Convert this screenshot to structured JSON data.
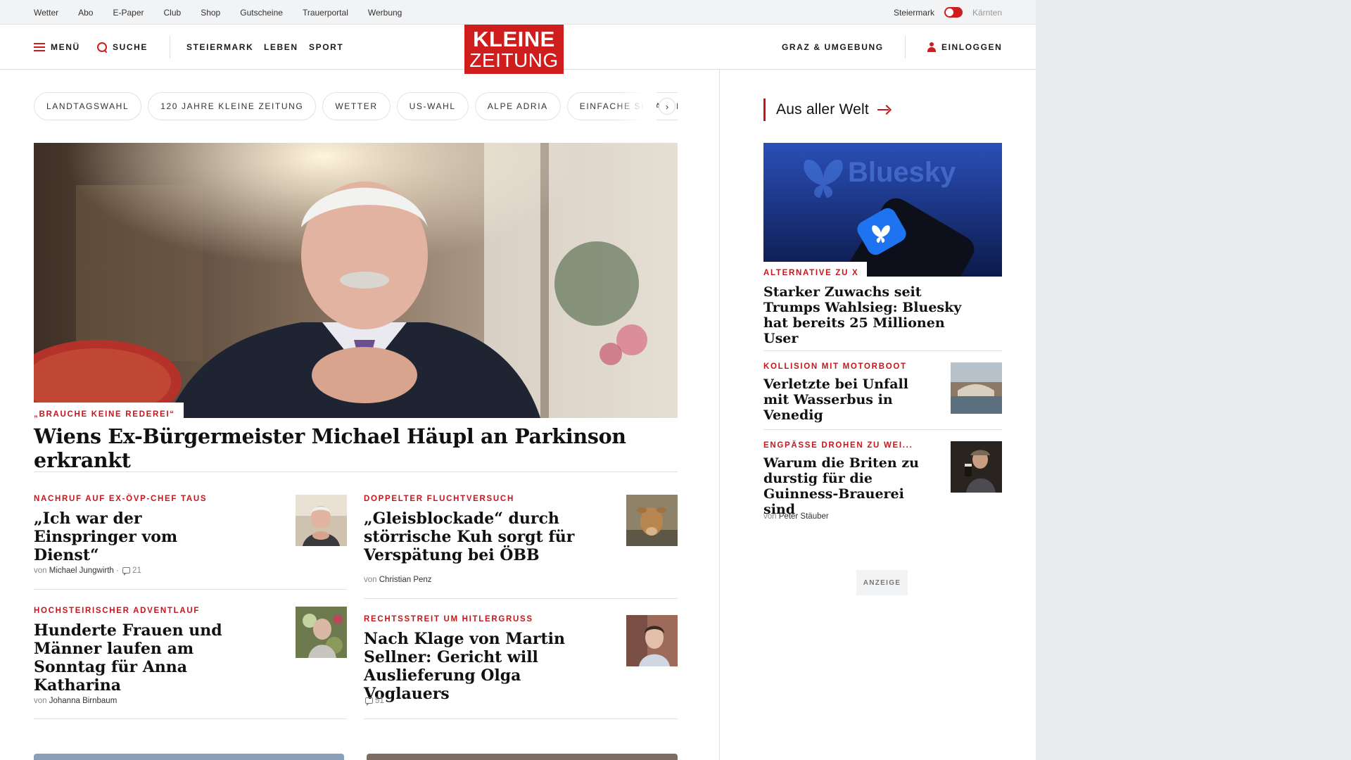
{
  "utility_nav": {
    "links": [
      "Wetter",
      "Abo",
      "E-Paper",
      "Club",
      "Shop",
      "Gutscheine",
      "Trauerportal",
      "Werbung"
    ],
    "region_active": "Steiermark",
    "region_other": "Kärnten"
  },
  "header": {
    "menu_label": "MENÜ",
    "search_label": "SUCHE",
    "nav": [
      "STEIERMARK",
      "LEBEN",
      "SPORT"
    ],
    "logo_line1": "KLEINE",
    "logo_line2": "ZEITUNG",
    "location_label": "GRAZ & UMGEBUNG",
    "login_label": "EINLOGGEN"
  },
  "topics": [
    "LANDTAGSWAHL",
    "120 JAHRE KLEINE ZEITUNG",
    "WETTER",
    "US-WAHL",
    "ALPE ADRIA",
    "EINFACHE SPRACHE"
  ],
  "hero": {
    "kicker": "„BRAUCHE KEINE REDEREI“",
    "title": "Wiens Ex-Bürgermeister Michael Häupl an Parkinson erkrankt"
  },
  "articles": [
    {
      "kicker": "NACHRUF AUF EX-ÖVP-CHEF TAUS",
      "title": "„Ich war der Einspringer vom Dienst“",
      "by": "von",
      "author": "Michael Jungwirth",
      "sep": "·",
      "comments": "21"
    },
    {
      "kicker": "DOPPELTER FLUCHTVERSUCH",
      "title": "„Gleisblockade“ durch störrische Kuh sorgt für Verspätung bei ÖBB",
      "by": "von",
      "author": "Christian Penz"
    },
    {
      "kicker": "HOCHSTEIRISCHER ADVENTLAUF",
      "title": "Hunderte Frauen und Männer laufen am Sonntag für Anna Katharina",
      "by": "von",
      "author": "Johanna Birnbaum"
    },
    {
      "kicker": "RECHTSSTREIT UM HITLERGRUSS",
      "title": "Nach Klage von Martin Sellner: Gericht will Auslieferung Olga Voglauers",
      "comments": "51"
    }
  ],
  "sidebar": {
    "section_title": "Aus aller Welt",
    "lead": {
      "kicker": "ALTERNATIVE ZU X",
      "title": "Starker Zuwachs seit Trumps Wahlsieg: Bluesky hat bereits 25 Millionen User",
      "image_text": "Bluesky"
    },
    "items": [
      {
        "kicker": "KOLLISION MIT MOTORBOOT",
        "title": "Verletzte bei Unfall mit Wasserbus in Venedig"
      },
      {
        "kicker": "ENGPÄSSE DROHEN ZU WEI...",
        "title": "Warum die Briten zu durstig für die Guinness-Brauerei sind",
        "by": "von",
        "author": "Peter Stäuber"
      }
    ],
    "ad_label": "ANZEIGE"
  },
  "colors": {
    "brand": "#cf1d1d",
    "kicker": "#c3171d"
  }
}
